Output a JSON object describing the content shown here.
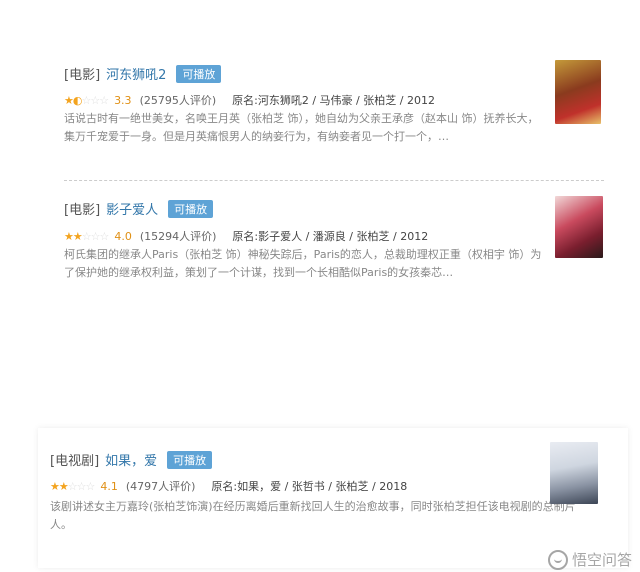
{
  "items": [
    {
      "category": "[电影]",
      "title": "河东狮吼2",
      "badge": "可播放",
      "stars_on": 1.5,
      "score": "3.3",
      "count": "(25795人评价)",
      "original": "原名:河东狮吼2 / 马伟豪 / 张柏芝 / 2012",
      "description": "话说古时有一绝世美女，名唤王月英（张柏芝 饰），她自幼为父亲王承彦（赵本山 饰）抚养长大，集万千宠爱于一身。但是月英痛恨男人的纳妾行为，有纳妾者见一个打一个，…"
    },
    {
      "category": "[电影]",
      "title": "影子爱人",
      "badge": "可播放",
      "stars_on": 2,
      "score": "4.0",
      "count": "(15294人评价)",
      "original": "原名:影子爱人 / 潘源良 / 张柏芝 / 2012",
      "description": "柯氏集团的继承人Paris（张柏芝 饰）神秘失踪后，Paris的恋人，总裁助理权正重（权相宇 饰）为了保护她的继承权利益，策划了一个计谋，找到一个长相酷似Paris的女孩秦芯…"
    },
    {
      "category": "[电视剧]",
      "title": "如果，爱",
      "badge": "可播放",
      "stars_on": 2,
      "score": "4.1",
      "count": "(4797人评价)",
      "original": "原名:如果，爱 / 张哲书 / 张柏芝 / 2018",
      "description": "该剧讲述女主万嘉玲(张柏芝饰演)在经历离婚后重新找回人生的治愈故事，同时张柏芝担任该电视剧的总制片人。"
    }
  ],
  "watermark": "悟空问答",
  "colors": {
    "link": "#3377aa",
    "badge": "#5ea3d6",
    "star": "#f3a31e",
    "score": "#e09015"
  }
}
